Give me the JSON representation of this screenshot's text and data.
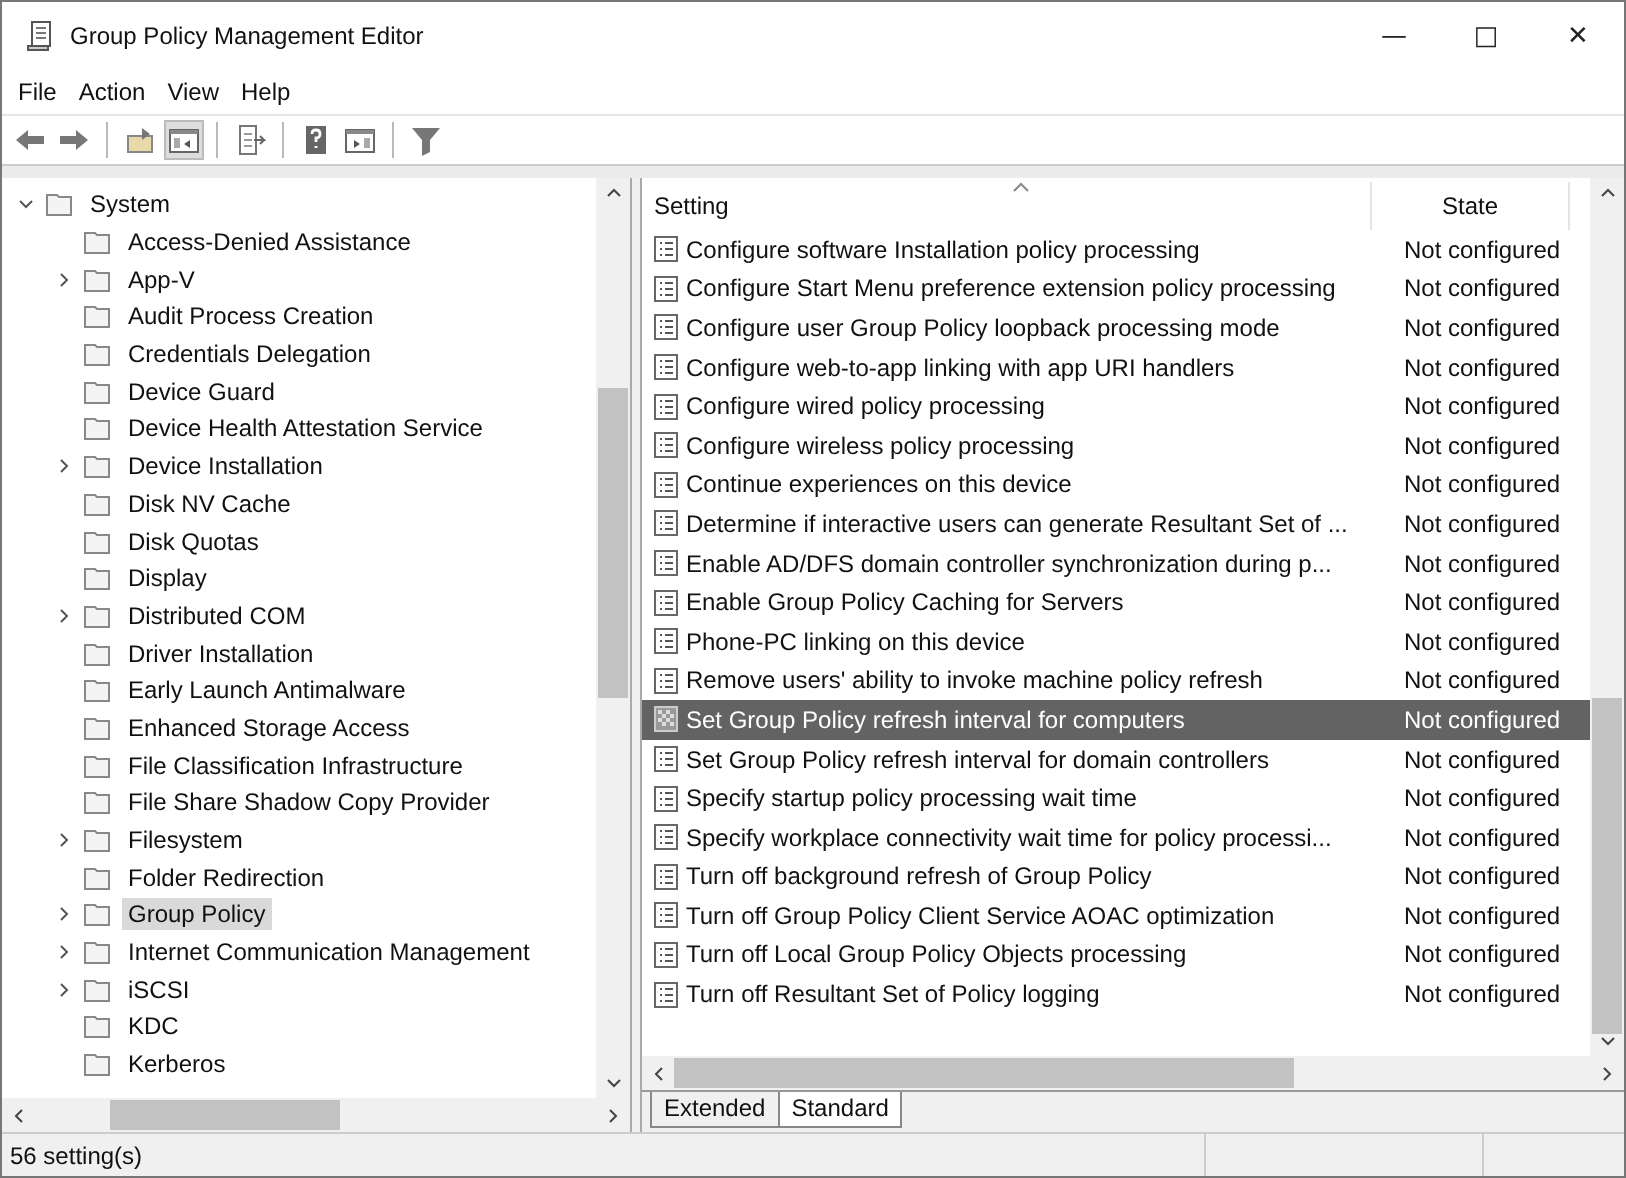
{
  "window": {
    "title": "Group Policy Management Editor",
    "controls": [
      "—",
      "□",
      "✕"
    ]
  },
  "menu": [
    "File",
    "Action",
    "View",
    "Help"
  ],
  "toolbar": [
    {
      "kind": "back"
    },
    {
      "kind": "forward"
    },
    {
      "kind": "sep"
    },
    {
      "kind": "up"
    },
    {
      "kind": "tree",
      "pressed": true
    },
    {
      "kind": "sep"
    },
    {
      "kind": "export"
    },
    {
      "kind": "sep"
    },
    {
      "kind": "help"
    },
    {
      "kind": "pane"
    },
    {
      "kind": "sep"
    },
    {
      "kind": "filter"
    }
  ],
  "tree": [
    {
      "label": "System",
      "expanded": true,
      "selected": false,
      "children": [
        {
          "label": "Access-Denied Assistance",
          "selected": false
        },
        {
          "label": "App-V",
          "expanded": false,
          "selected": false
        },
        {
          "label": "Audit Process Creation",
          "selected": false
        },
        {
          "label": "Credentials Delegation",
          "selected": false
        },
        {
          "label": "Device Guard",
          "selected": false
        },
        {
          "label": "Device Health Attestation Service",
          "selected": false
        },
        {
          "label": "Device Installation",
          "expanded": false,
          "selected": false
        },
        {
          "label": "Disk NV Cache",
          "selected": false
        },
        {
          "label": "Disk Quotas",
          "selected": false
        },
        {
          "label": "Display",
          "selected": false
        },
        {
          "label": "Distributed COM",
          "expanded": false,
          "selected": false
        },
        {
          "label": "Driver Installation",
          "selected": false
        },
        {
          "label": "Early Launch Antimalware",
          "selected": false
        },
        {
          "label": "Enhanced Storage Access",
          "selected": false
        },
        {
          "label": "File Classification Infrastructure",
          "selected": false
        },
        {
          "label": "File Share Shadow Copy Provider",
          "selected": false
        },
        {
          "label": "Filesystem",
          "expanded": false,
          "selected": false
        },
        {
          "label": "Folder Redirection",
          "selected": false
        },
        {
          "label": "Group Policy",
          "expanded": false,
          "selected": true
        },
        {
          "label": "Internet Communication Management",
          "expanded": false,
          "selected": false
        },
        {
          "label": "iSCSI",
          "expanded": false,
          "selected": false
        },
        {
          "label": "KDC",
          "selected": false
        },
        {
          "label": "Kerberos",
          "selected": false
        }
      ]
    }
  ],
  "table": {
    "columns": [
      "Setting",
      "State"
    ],
    "rows": [
      {
        "setting": "Configure software Installation policy processing",
        "state": "Not configured",
        "selected": false
      },
      {
        "setting": "Configure Start Menu preference extension policy processing",
        "state": "Not configured",
        "selected": false
      },
      {
        "setting": "Configure user Group Policy loopback processing mode",
        "state": "Not configured",
        "selected": false
      },
      {
        "setting": "Configure web-to-app linking with app URI handlers",
        "state": "Not configured",
        "selected": false
      },
      {
        "setting": "Configure wired policy processing",
        "state": "Not configured",
        "selected": false
      },
      {
        "setting": "Configure wireless policy processing",
        "state": "Not configured",
        "selected": false
      },
      {
        "setting": "Continue experiences on this device",
        "state": "Not configured",
        "selected": false
      },
      {
        "setting": "Determine if interactive users can generate Resultant Set of ...",
        "state": "Not configured",
        "selected": false
      },
      {
        "setting": "Enable AD/DFS domain controller synchronization during p...",
        "state": "Not configured",
        "selected": false
      },
      {
        "setting": "Enable Group Policy Caching for Servers",
        "state": "Not configured",
        "selected": false
      },
      {
        "setting": "Phone-PC linking on this device",
        "state": "Not configured",
        "selected": false
      },
      {
        "setting": "Remove users' ability to invoke machine policy refresh",
        "state": "Not configured",
        "selected": false
      },
      {
        "setting": "Set Group Policy refresh interval for computers",
        "state": "Not configured",
        "selected": true
      },
      {
        "setting": "Set Group Policy refresh interval for domain controllers",
        "state": "Not configured",
        "selected": false
      },
      {
        "setting": "Specify startup policy processing wait time",
        "state": "Not configured",
        "selected": false
      },
      {
        "setting": "Specify workplace connectivity wait time for policy processi...",
        "state": "Not configured",
        "selected": false
      },
      {
        "setting": "Turn off background refresh of Group Policy",
        "state": "Not configured",
        "selected": false
      },
      {
        "setting": "Turn off Group Policy Client Service AOAC optimization",
        "state": "Not configured",
        "selected": false
      },
      {
        "setting": "Turn off Local Group Policy Objects processing",
        "state": "Not configured",
        "selected": false
      },
      {
        "setting": "Turn off Resultant Set of Policy logging",
        "state": "Not configured",
        "selected": false
      }
    ]
  },
  "view_tabs": [
    {
      "label": "Extended",
      "selected": false
    },
    {
      "label": "Standard",
      "selected": true
    }
  ],
  "status_bar": {
    "text": "56 setting(s)"
  }
}
